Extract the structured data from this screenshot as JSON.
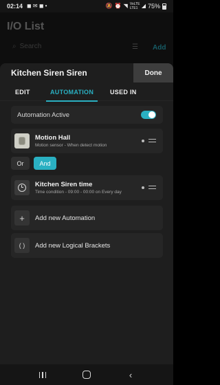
{
  "status_bar": {
    "time": "02:14",
    "battery": "75%",
    "network": "VoLTE LTE1"
  },
  "background": {
    "title": "I/O List",
    "search_placeholder": "Search",
    "add_label": "Add"
  },
  "sheet": {
    "title": "Kitchen Siren Siren",
    "done_label": "Done",
    "tabs": [
      {
        "label": "EDIT",
        "active": false
      },
      {
        "label": "AUTOMATION",
        "active": true
      },
      {
        "label": "USED IN",
        "active": false
      }
    ],
    "automation_active_label": "Automation Active",
    "automation_active": true,
    "conditions": [
      {
        "title": "Motion Hall",
        "subtitle": "Motion sensor - When detect motion",
        "icon": "motion-sensor-icon"
      },
      {
        "title": "Kitchen Siren time",
        "subtitle": "Time condition - 09:00 - 00:00 on Every day",
        "icon": "clock-icon"
      }
    ],
    "logic": {
      "or_label": "Or",
      "and_label": "And",
      "selected": "And"
    },
    "actions": [
      {
        "icon_glyph": "+",
        "label": "Add new Automation"
      },
      {
        "icon_glyph": "( )",
        "label": "Add new Logical Brackets"
      }
    ]
  },
  "colors": {
    "accent": "#2ab0c2",
    "sheet_bg": "#1e1e1e",
    "card_bg": "#262626"
  }
}
